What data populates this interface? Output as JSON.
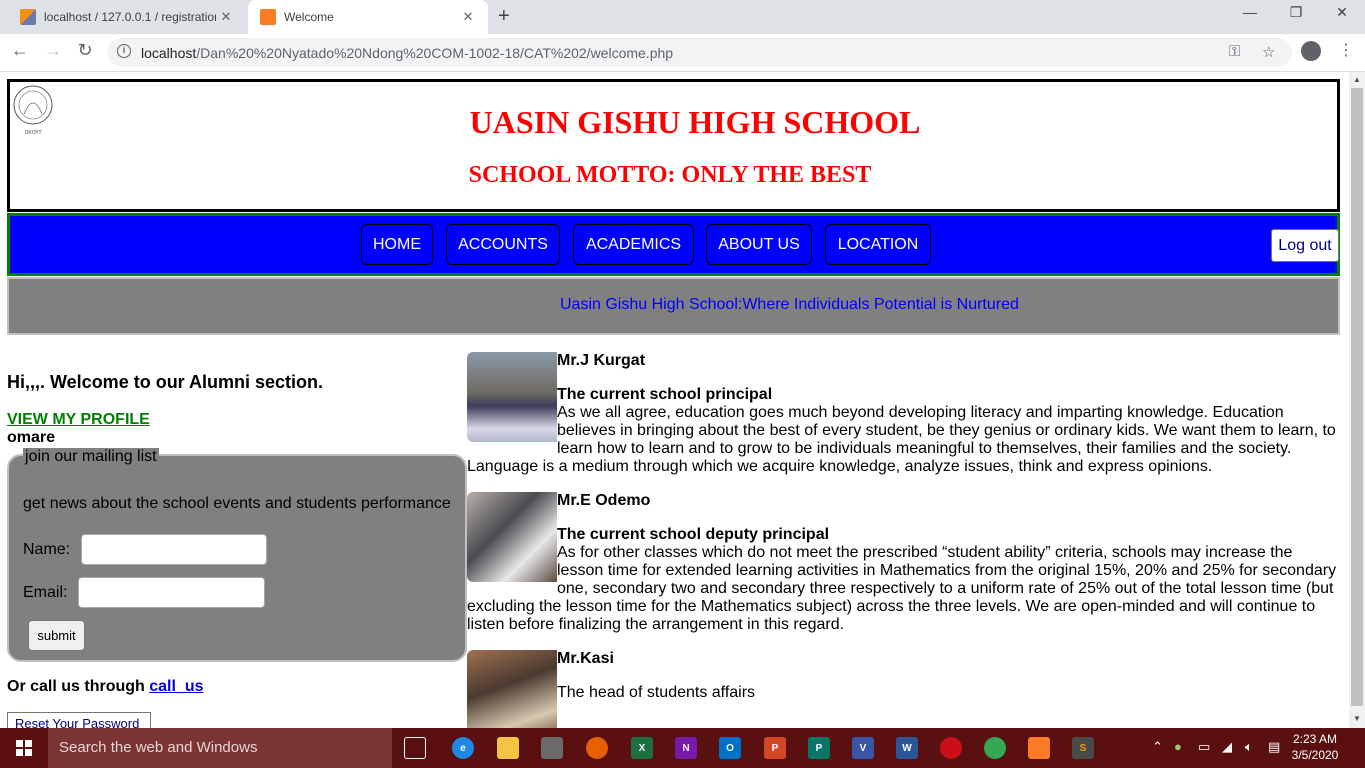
{
  "browser": {
    "tabs": [
      {
        "title": "localhost / 127.0.0.1 / registration",
        "close": "✕"
      },
      {
        "title": "Welcome",
        "close": "✕"
      }
    ],
    "new_tab": "+",
    "window_controls": {
      "minimize": "—",
      "restore": "❐",
      "close": "✕"
    },
    "url_host": "localhost",
    "url_path": "/Dan%20%20Nyatado%20Ndong%20COM-1002-18/CAT%202/welcome.php"
  },
  "header": {
    "school_name": "UASIN GISHU HIGH SCHOOL",
    "motto": "SCHOOL MOTTO: ONLY THE BEST",
    "logo_text": "DROYT"
  },
  "nav": {
    "items": [
      "HOME",
      "ACCOUNTS",
      "ACADEMICS",
      "ABOUT US",
      "LOCATION"
    ],
    "logout": "Log out"
  },
  "banner": {
    "text": "Uasin Gishu High School:Where Individuals Potential is Nurtured"
  },
  "left": {
    "welcome": "Hi,,,. Welcome to our Alumni section.",
    "profile_link": "VIEW MY PROFILE",
    "username": "omare",
    "mailing": {
      "legend": "join our mailing list",
      "description": "get news about the school events and students performance",
      "name_label": "Name:",
      "email_label": "Email:",
      "submit": "submit"
    },
    "call_prefix": "Or call us through ",
    "call_link": "call_us",
    "reset_button": "Reset Your Password"
  },
  "staff": [
    {
      "name": "Mr.J Kurgat",
      "role": "The current school principal",
      "bio": "As we all agree, education goes much beyond developing literacy and imparting knowledge. Education believes in bringing about the best of every student, be they genius or ordinary kids. We want them to learn, to learn how to learn and to grow to be individuals meaningful to themselves, their families and the society. Language is a medium through which we acquire knowledge, analyze issues, think and express opinions."
    },
    {
      "name": "Mr.E Odemo",
      "role": "The current school deputy principal",
      "bio": "As for other classes which do not meet the prescribed “student ability” criteria, schools may increase the lesson time for extended learning activities in Mathematics from the original 15%, 20% and 25% for secondary one, secondary two and secondary three respectively to a uniform rate of 25% out of the total lesson time (but excluding the lesson time for the Mathematics subject) across the three levels. We are open-minded and will continue to listen before finalizing the arrangement in this regard."
    },
    {
      "name": "Mr.Kasi",
      "role": "",
      "bio": "The head of students affairs"
    }
  ],
  "taskbar": {
    "search_placeholder": "Search the web and Windows",
    "time": "2:23 AM",
    "date": "3/5/2020"
  },
  "colors": {
    "title_red": "#ff0000",
    "nav_blue": "#0000ff",
    "nav_border_green": "#008000",
    "banner_gray": "#808080",
    "taskbar": "#5a0f10"
  }
}
